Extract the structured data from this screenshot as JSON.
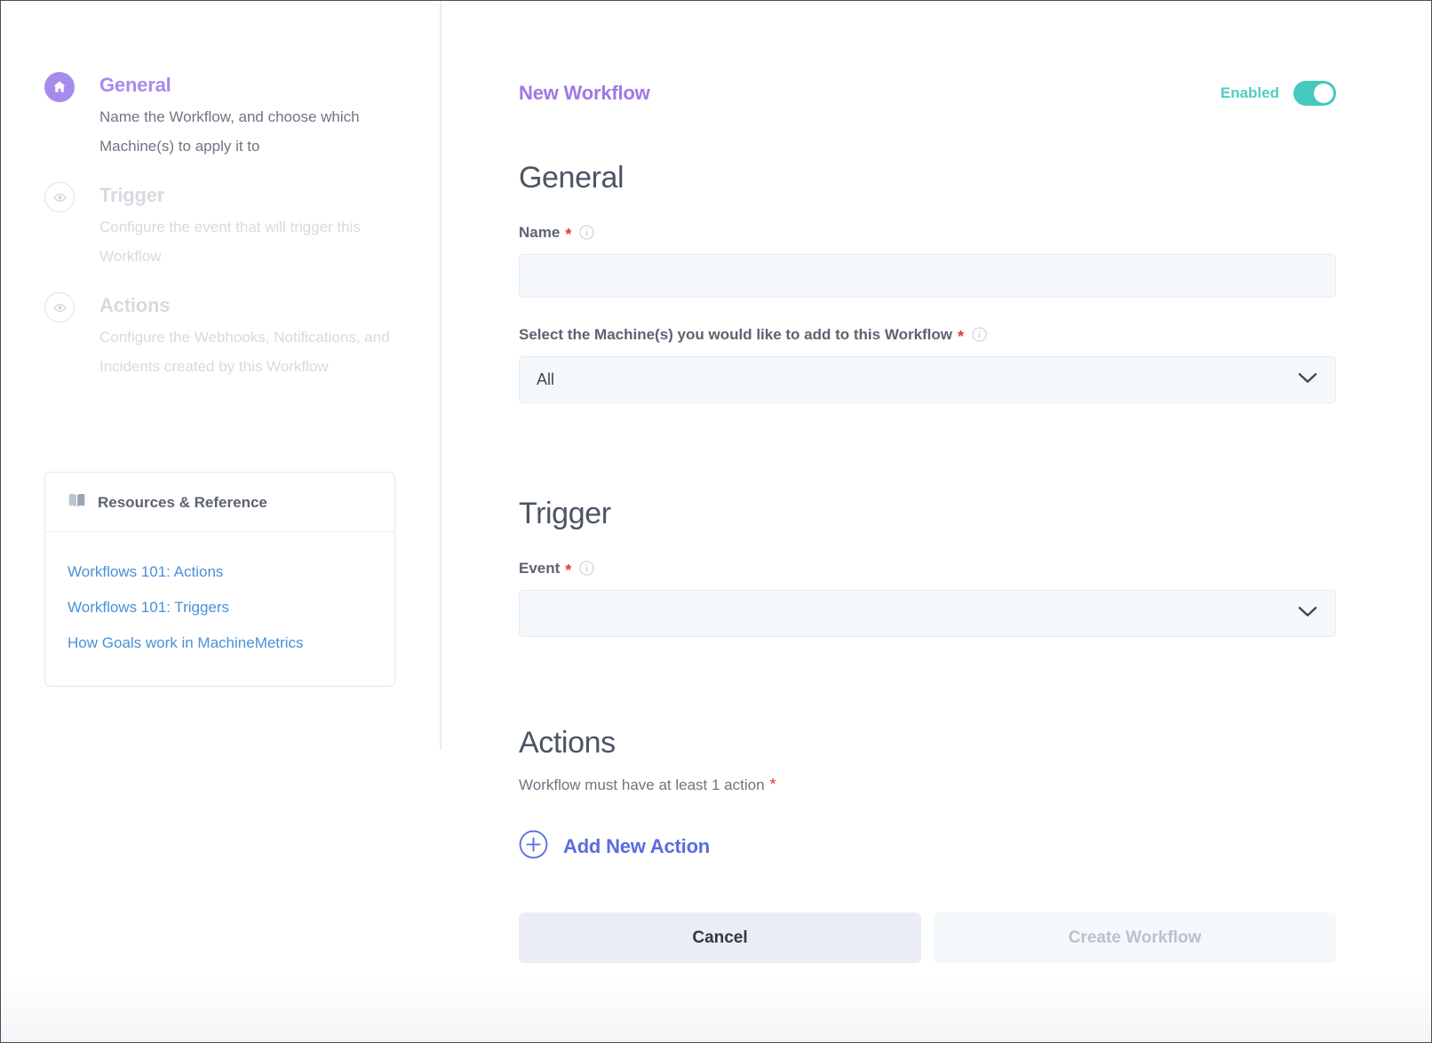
{
  "sidebar": {
    "steps": [
      {
        "icon": "home-icon",
        "title": "General",
        "description": "Name the Workflow, and choose which Machine(s) to apply it to",
        "state": "active"
      },
      {
        "icon": "eye-icon",
        "title": "Trigger",
        "description": "Configure the event that will trigger this Workflow",
        "state": "inactive"
      },
      {
        "icon": "eye-icon",
        "title": "Actions",
        "description": "Configure the Webhooks, Notifications, and Incidents created by this Workflow",
        "state": "inactive"
      }
    ],
    "resources": {
      "icon": "book-icon",
      "title": "Resources & Reference",
      "links": [
        "Workflows 101: Actions",
        "Workflows 101: Triggers",
        "How Goals work in MachineMetrics"
      ]
    }
  },
  "header": {
    "title": "New Workflow",
    "toggle_label": "Enabled",
    "toggle_state": "on"
  },
  "general": {
    "heading": "General",
    "name_field": {
      "label": "Name",
      "required_marker": "*",
      "value": "",
      "placeholder": ""
    },
    "machines_field": {
      "label": "Select the Machine(s) you would like to add to this Workflow",
      "required_marker": "*",
      "selected": "All"
    }
  },
  "trigger": {
    "heading": "Trigger",
    "event_field": {
      "label": "Event",
      "required_marker": "*",
      "selected": ""
    }
  },
  "actions": {
    "heading": "Actions",
    "note": "Workflow must have at least 1 action",
    "required_marker": "*",
    "add_button_label": "Add New Action",
    "add_button_icon": "plus-circle-icon"
  },
  "footer": {
    "cancel_label": "Cancel",
    "create_label": "Create Workflow"
  },
  "colors": {
    "accent_purple": "#a078e8",
    "step_active": "#a78bea",
    "toggle_teal": "#45c9bf",
    "link_blue": "#4a90d9",
    "add_action_indigo": "#5a6ce0",
    "required_red": "#e0393e",
    "heading_slate": "#4b5563"
  }
}
